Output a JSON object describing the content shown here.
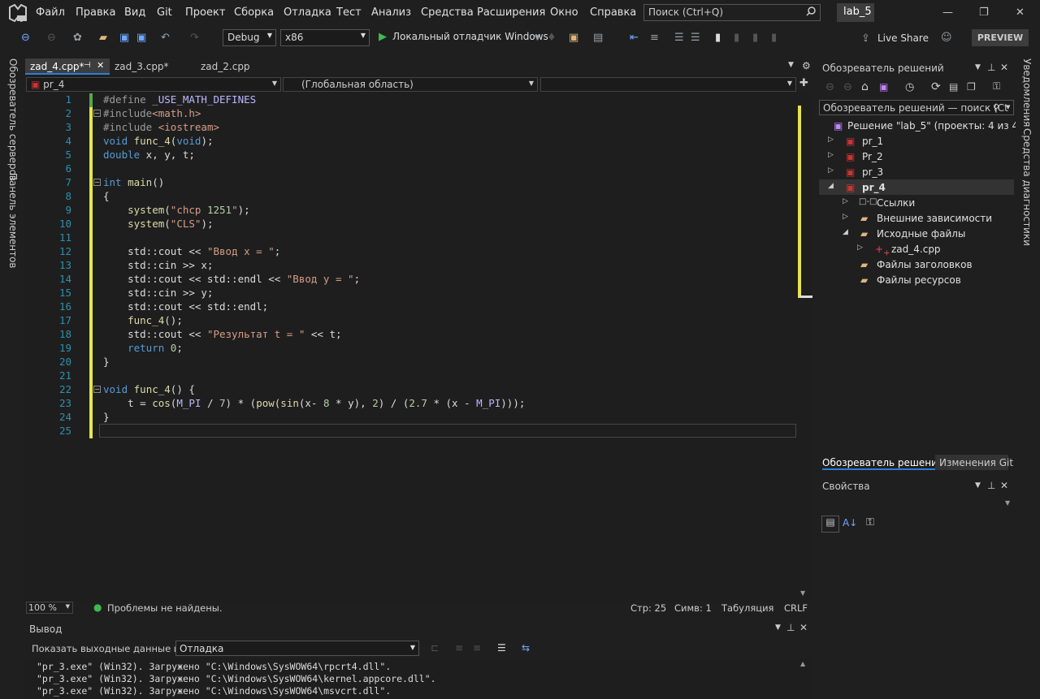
{
  "menu": [
    "Файл",
    "Правка",
    "Вид",
    "Git",
    "Проект",
    "Сборка",
    "Отладка",
    "Тест",
    "Анализ",
    "Средства",
    "Расширения",
    "Окно",
    "Справка"
  ],
  "search": {
    "placeholder": "Поиск (Ctrl+Q)"
  },
  "solution_name": "lab_5",
  "toolbar": {
    "config": "Debug",
    "platform": "x86",
    "run_label": "Локальный отладчик Windows",
    "live_share": "Live Share",
    "preview": "PREVIEW"
  },
  "left_rail": [
    "Обозреватель серверов",
    "Панель элементов"
  ],
  "right_rail": [
    "Уведомления",
    "Средства диагностики"
  ],
  "tabs": [
    {
      "label": "zad_4.cpp*",
      "active": true
    },
    {
      "label": "zad_3.cpp*",
      "active": false
    },
    {
      "label": "zad_2.cpp",
      "active": false
    }
  ],
  "nav": {
    "project": "pr_4",
    "scope": "(Глобальная область)",
    "member": ""
  },
  "code_lines": [
    {
      "n": "1",
      "t": "#define _USE_MATH_DEFINES"
    },
    {
      "n": "2",
      "t": "#include<math.h>"
    },
    {
      "n": "3",
      "t": "#include <iostream>"
    },
    {
      "n": "4",
      "t": "void func_4(void);"
    },
    {
      "n": "5",
      "t": "double x, y, t;"
    },
    {
      "n": "6",
      "t": ""
    },
    {
      "n": "7",
      "t": "int main()"
    },
    {
      "n": "8",
      "t": "{"
    },
    {
      "n": "9",
      "t": "    system(\"chcp 1251\");"
    },
    {
      "n": "10",
      "t": "    system(\"CLS\");"
    },
    {
      "n": "11",
      "t": ""
    },
    {
      "n": "12",
      "t": "    std::cout << \"Ввод x = \";"
    },
    {
      "n": "13",
      "t": "    std::cin >> x;"
    },
    {
      "n": "14",
      "t": "    std::cout << std::endl << \"Ввод y = \";"
    },
    {
      "n": "15",
      "t": "    std::cin >> y;"
    },
    {
      "n": "16",
      "t": "    std::cout << std::endl;"
    },
    {
      "n": "17",
      "t": "    func_4();"
    },
    {
      "n": "18",
      "t": "    std::cout << \"Результат t = \" << t;"
    },
    {
      "n": "19",
      "t": "    return 0;"
    },
    {
      "n": "20",
      "t": "}"
    },
    {
      "n": "21",
      "t": ""
    },
    {
      "n": "22",
      "t": "void func_4() {"
    },
    {
      "n": "23",
      "t": "    t = cos(M_PI / 7) * (pow(sin(x- 8 * y), 2) / (2.7 * (x - M_PI)));"
    },
    {
      "n": "24",
      "t": "}"
    },
    {
      "n": "25",
      "t": ""
    }
  ],
  "status": {
    "zoom": "100 %",
    "problems": "Проблемы не найдены.",
    "line": "Стр: 25",
    "col": "Симв: 1",
    "tabs": "Табуляция",
    "eol": "CRLF"
  },
  "output": {
    "title": "Вывод",
    "show_from_label": "Показать выходные данные из:",
    "source": "Отладка",
    "lines": [
      "\"pr_3.exe\" (Win32). Загружено \"C:\\Windows\\SysWOW64\\rpcrt4.dll\".",
      "\"pr_3.exe\" (Win32). Загружено \"C:\\Windows\\SysWOW64\\kernel.appcore.dll\".",
      "\"pr_3.exe\" (Win32). Загружено \"C:\\Windows\\SysWOW64\\msvcrt.dll\"."
    ]
  },
  "solution_explorer": {
    "title": "Обозреватель решений",
    "search_placeholder": "Обозреватель решений — поиск (Ct",
    "solution": "Решение \"lab_5\" (проекты: 4 из 4)",
    "projects": [
      "pr_1",
      "Pr_2",
      "pr_3",
      "pr_4"
    ],
    "children": [
      "Ссылки",
      "Внешние зависимости",
      "Исходные файлы",
      "zad_4.cpp",
      "Файлы заголовков",
      "Файлы ресурсов"
    ],
    "bottom_tabs": [
      "Обозреватель решений",
      "Изменения Git"
    ]
  },
  "properties": {
    "title": "Свойства"
  }
}
